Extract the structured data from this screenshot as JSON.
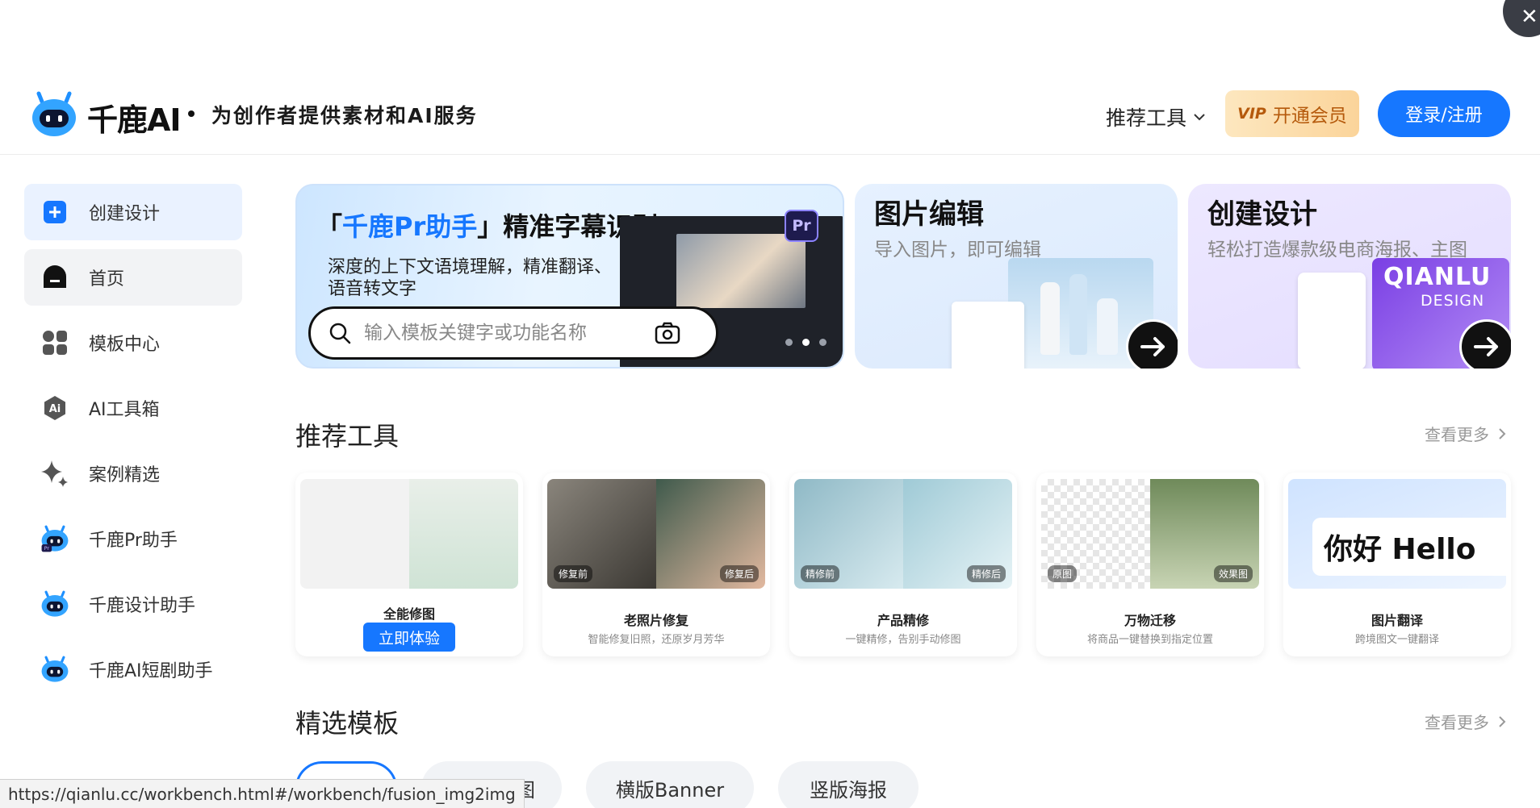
{
  "header": {
    "brand": "千鹿AI",
    "slogan": "为创作者提供素材和AI服务",
    "nav_tools": "推荐工具",
    "vip_tag": "VIP",
    "vip_label": "开通会员",
    "login_label": "登录/注册"
  },
  "sidebar": {
    "items": [
      {
        "label": "创建设计",
        "icon": "plus-square-icon"
      },
      {
        "label": "首页",
        "icon": "home-icon"
      },
      {
        "label": "模板中心",
        "icon": "grid-icon"
      },
      {
        "label": "AI工具箱",
        "icon": "ai-toolbox-icon"
      },
      {
        "label": "案例精选",
        "icon": "sparkle-icon"
      },
      {
        "label": "千鹿Pr助手",
        "icon": "pr-robot-icon"
      },
      {
        "label": "千鹿设计助手",
        "icon": "robot-icon"
      },
      {
        "label": "千鹿AI短剧助手",
        "icon": "robot-icon"
      }
    ]
  },
  "banner": {
    "title_prefix": "「",
    "title_blue": "千鹿Pr助手",
    "title_suffix": "」精准字幕识别",
    "subtitle": "深度的上下文语境理解，精准翻译、语音转文字",
    "pr_badge": "Pr",
    "search_placeholder": "输入模板关键字或功能名称"
  },
  "cards": {
    "edit": {
      "title": "图片编辑",
      "subtitle": "导入图片，即可编辑"
    },
    "design": {
      "title": "创建设计",
      "subtitle": "轻松打造爆款级电商海报、主图",
      "poster_line1": "QIANLU",
      "poster_line2": "DESIGN"
    }
  },
  "recommend": {
    "title": "推荐工具",
    "see_more": "查看更多",
    "tools": [
      {
        "name": "全能修图",
        "desc": "",
        "button": "立即体验"
      },
      {
        "name": "老照片修复",
        "desc": "智能修复旧照，还原岁月芳华",
        "tag_before": "修复前",
        "tag_after": "修复后"
      },
      {
        "name": "产品精修",
        "desc": "一键精修，告别手动修图",
        "tag_before": "精修前",
        "tag_after": "精修后"
      },
      {
        "name": "万物迁移",
        "desc": "将商品一键替换到指定位置",
        "tag_before": "原图",
        "tag_after": "效果图"
      },
      {
        "name": "图片翻译",
        "desc": "跨境图文一键翻译",
        "sample_text": "你好 Hello"
      }
    ]
  },
  "templates": {
    "title": "精选模板",
    "see_more": "查看更多",
    "tabs": [
      "",
      "主图",
      "横版Banner",
      "竖版海报"
    ]
  },
  "status_url": "https://qianlu.cc/workbench.html#/workbench/fusion_img2img",
  "colors": {
    "accent": "#1677ff",
    "vip": "#fbd49a",
    "dark": "#111111"
  }
}
